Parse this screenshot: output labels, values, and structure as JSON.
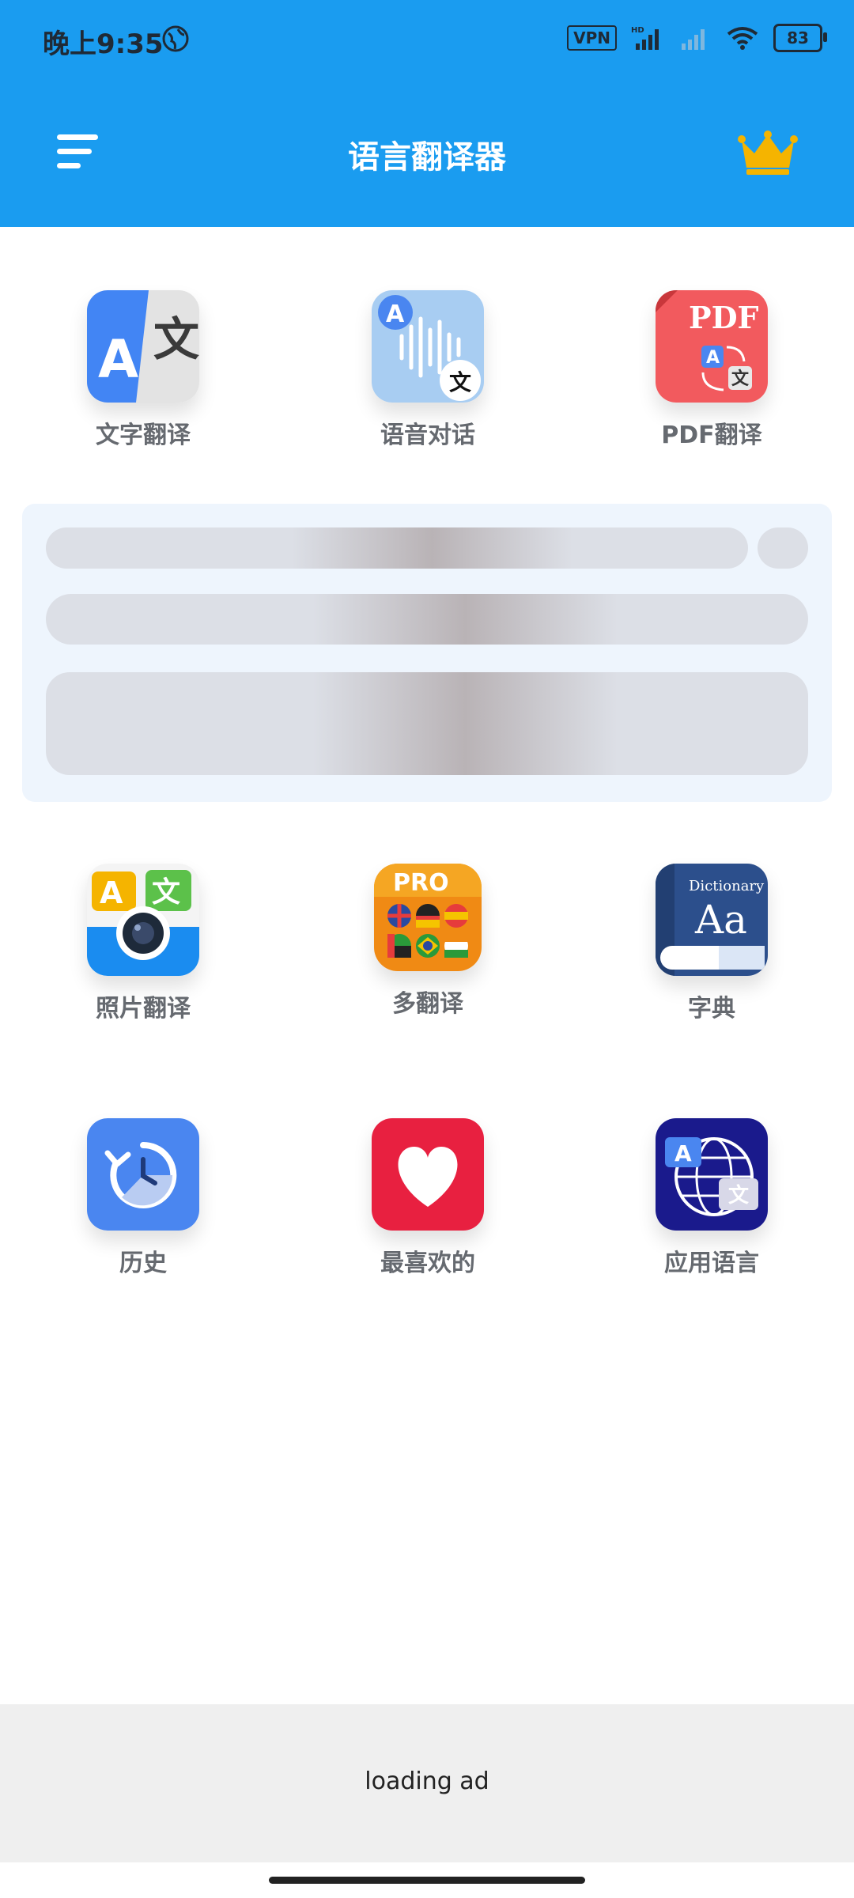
{
  "status_bar": {
    "time": "晚上9:35",
    "vpn": "VPN",
    "battery": "83"
  },
  "header": {
    "title": "语言翻译器",
    "accent_color": "#1a9cf0",
    "crown_color": "#f5b400"
  },
  "features": {
    "text_translate": "文字翻译",
    "voice_chat": "语音对话",
    "pdf_translate": "PDF翻译",
    "photo_translate": "照片翻译",
    "multi_translate": "多翻译",
    "dictionary": "字典",
    "history": "历史",
    "favorites": "最喜欢的",
    "app_language": "应用语言"
  },
  "icon_text": {
    "pdf": "PDF",
    "pro": "PRO",
    "dictionary_word": "Dictionary",
    "dictionary_aa": "Aa",
    "letter_a": "A",
    "letter_wen": "文"
  },
  "ad": {
    "text": "loading ad"
  }
}
